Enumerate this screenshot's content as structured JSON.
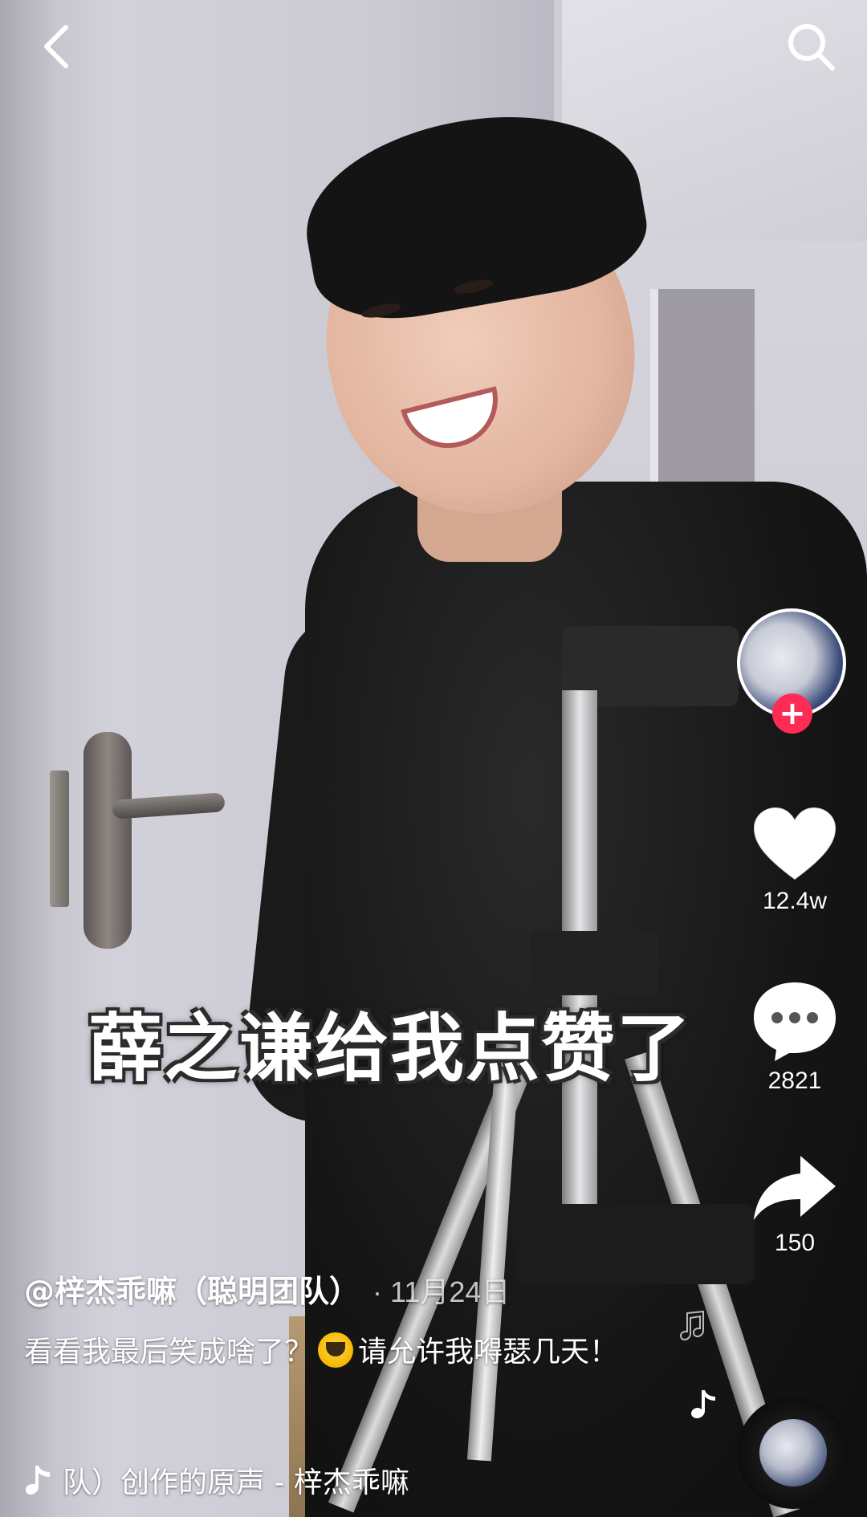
{
  "topbar": {
    "back_icon": "chevron-left-icon",
    "search_icon": "search-icon"
  },
  "video": {
    "caption_overlay": "薛之谦给我点赞了"
  },
  "actions": {
    "likes": "12.4w",
    "comments": "2821",
    "shares": "150",
    "follow_symbol": "+"
  },
  "post": {
    "author": "@梓杰乖嘛（聪明团队）",
    "date": "· 11月24日",
    "description_part1": "看看我最后笑成啥了？",
    "description_part2": "请允许我嘚瑟几天！",
    "music": "队）创作的原声 - 梓杰乖嘛"
  },
  "colors": {
    "accent": "#fe2c55",
    "text": "#ffffff"
  }
}
